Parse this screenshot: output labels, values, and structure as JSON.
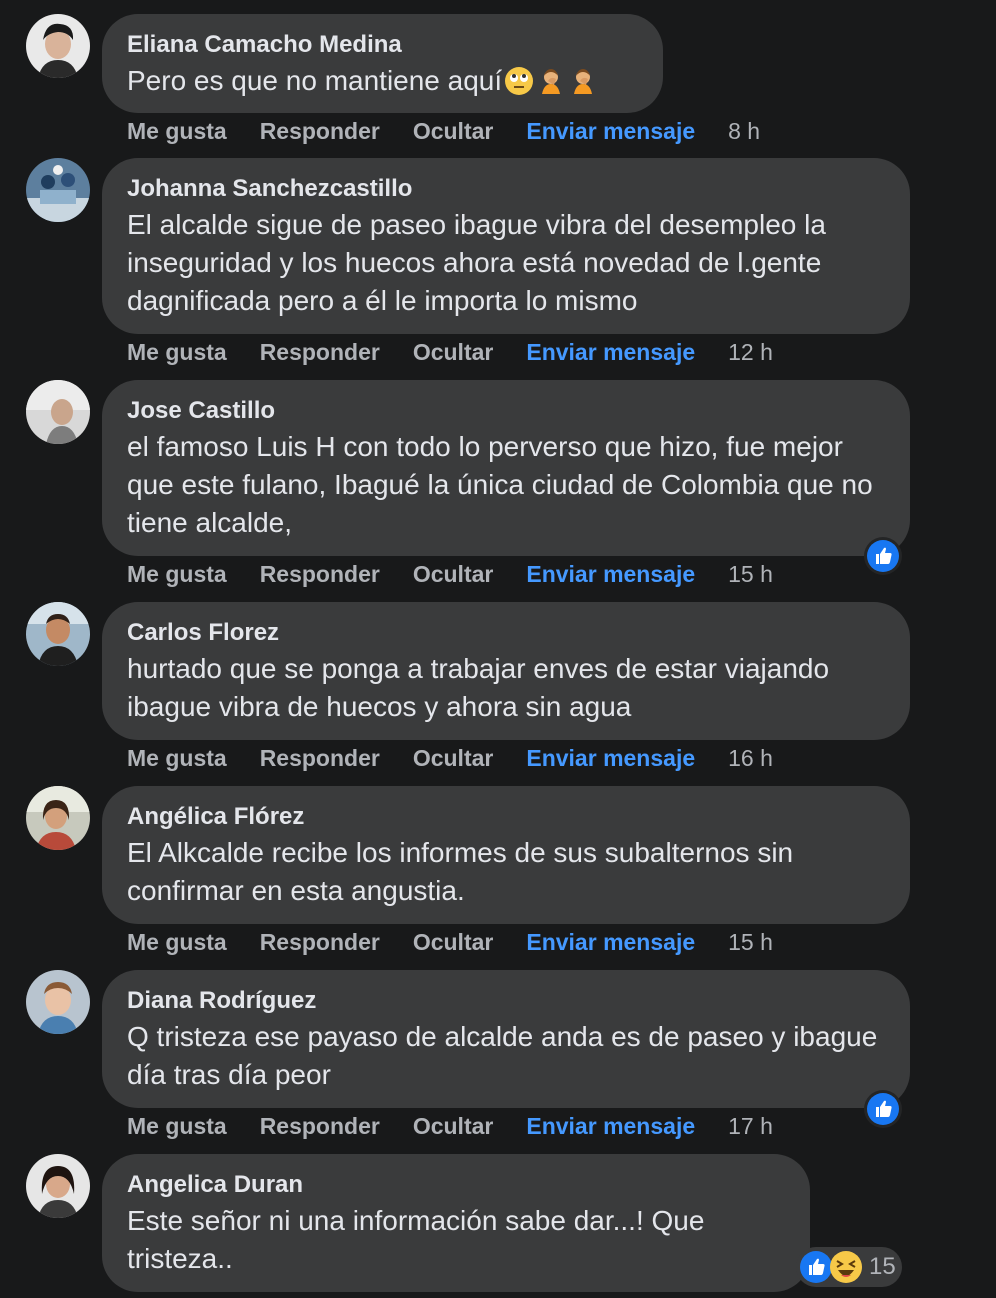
{
  "colors": {
    "background": "#18191a",
    "bubble": "#3a3b3c",
    "link": "#4599ff",
    "muted": "#b0b3b8",
    "text": "#e4e6eb",
    "like": "#1877f2"
  },
  "comments": [
    {
      "author": "Eliana Camacho Medina",
      "text": "Pero es que no mantiene aquí",
      "emojis": [
        "face-with-rolling-eyes",
        "person-facepalming",
        "person-facepalming"
      ],
      "actions": {
        "like": "Me gusta",
        "reply": "Responder",
        "hide": "Ocultar",
        "message": "Enviar mensaje"
      },
      "time": "8 h"
    },
    {
      "author": "Johanna Sanchezcastillo",
      "text": "El alcalde sigue de paseo ibague vibra del desempleo la inseguridad y los huecos ahora está novedad de l.gente dagnificada pero a él le importa lo mismo",
      "actions": {
        "like": "Me gusta",
        "reply": "Responder",
        "hide": "Ocultar",
        "message": "Enviar mensaje"
      },
      "time": "12 h"
    },
    {
      "author": "Jose Castillo",
      "text": "el famoso Luis H con todo lo perverso que hizo, fue mejor que este fulano, Ibagué la única ciudad de Colombia que no tiene alcalde,",
      "reaction_icon": "like-icon",
      "actions": {
        "like": "Me gusta",
        "reply": "Responder",
        "hide": "Ocultar",
        "message": "Enviar mensaje"
      },
      "time": "15 h"
    },
    {
      "author": "Carlos Florez",
      "text": "hurtado que se ponga a trabajar enves de estar viajando ibague vibra de huecos y ahora sin agua",
      "actions": {
        "like": "Me gusta",
        "reply": "Responder",
        "hide": "Ocultar",
        "message": "Enviar mensaje"
      },
      "time": "16 h"
    },
    {
      "author": "Angélica Flórez",
      "text": "El Alkcalde recibe los informes de sus subalternos sin confirmar en esta angustia.",
      "actions": {
        "like": "Me gusta",
        "reply": "Responder",
        "hide": "Ocultar",
        "message": "Enviar mensaje"
      },
      "time": "15 h"
    },
    {
      "author": "Diana Rodríguez",
      "text": "Q tristeza ese payaso de alcalde anda es de paseo y ibague día tras día peor",
      "reaction_icon": "like-icon",
      "actions": {
        "like": "Me gusta",
        "reply": "Responder",
        "hide": "Ocultar",
        "message": "Enviar mensaje"
      },
      "time": "17 h"
    },
    {
      "author": "Angelica Duran",
      "text": "Este señor ni una información sabe dar...! Que tristeza..",
      "reaction_icons": [
        "like-icon",
        "haha-icon"
      ],
      "reaction_count": "15"
    }
  ]
}
